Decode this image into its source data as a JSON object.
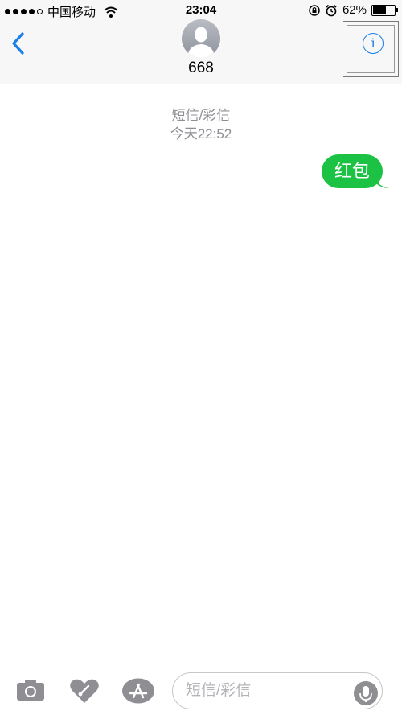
{
  "status": {
    "carrier": "中国移动",
    "time": "23:04",
    "battery_text": "62%",
    "battery_level": 0.62
  },
  "nav": {
    "contact_name": "668",
    "info_glyph": "i",
    "accent_color": "#1a7fe8"
  },
  "conversation": {
    "kind": "短信/彩信",
    "timestamp": "今天22:52",
    "messages": [
      {
        "text": "红包",
        "direction": "outgoing",
        "color": "#1bc244"
      }
    ]
  },
  "input": {
    "placeholder": "短信/彩信"
  },
  "icons": {
    "back": "chevron-left-icon",
    "info": "info-icon",
    "camera": "camera-icon",
    "digital_touch": "heart-icon",
    "app_store": "app-store-icon",
    "mic": "microphone-icon"
  }
}
